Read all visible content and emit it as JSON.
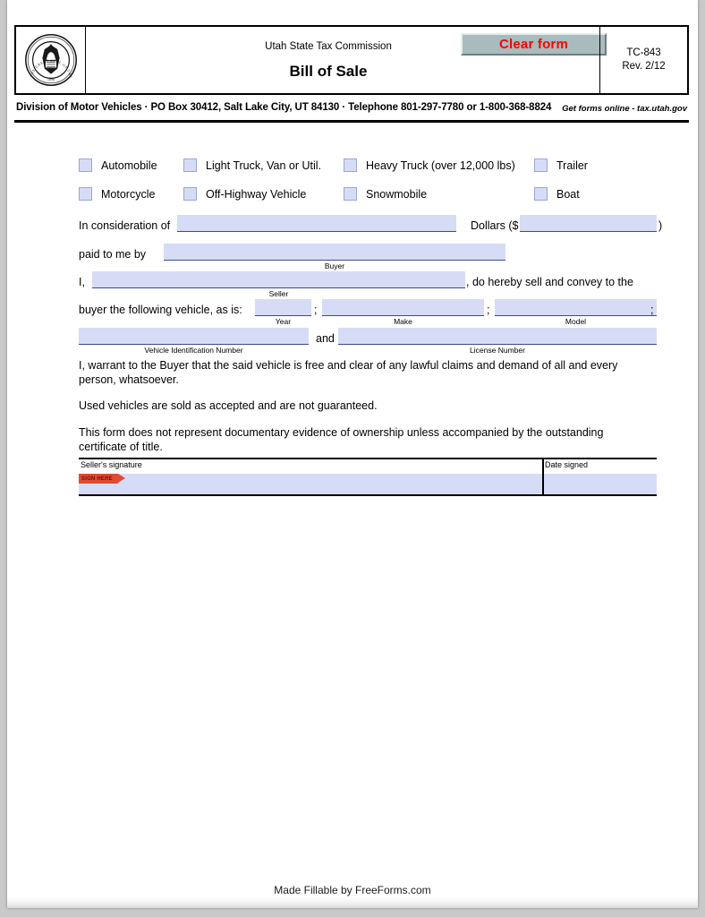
{
  "header": {
    "seal_name": "utah-state-seal",
    "agency": "Utah State Tax Commission",
    "title": "Bill of Sale",
    "clear_button": "Clear form",
    "form_code": "TC-843",
    "revision": "Rev. 2/12"
  },
  "division_line": "Division of Motor Vehicles · PO Box 30412, Salt Lake City, UT 84130 · Telephone 801-297-7780 or 1-800-368-8824",
  "get_forms": "Get forms online - tax.utah.gov",
  "vehicle_types": [
    {
      "label": "Automobile",
      "checked": false
    },
    {
      "label": "Light Truck, Van or Util.",
      "checked": false
    },
    {
      "label": "Heavy Truck (over 12,000 lbs)",
      "checked": false
    },
    {
      "label": "Trailer",
      "checked": false
    },
    {
      "label": "Motorcycle",
      "checked": false
    },
    {
      "label": "Off-Highway Vehicle",
      "checked": false
    },
    {
      "label": "Snowmobile",
      "checked": false
    },
    {
      "label": "Boat",
      "checked": false
    }
  ],
  "body": {
    "in_consideration_label": "In consideration of",
    "consideration_value": "",
    "dollars_label": "Dollars ($",
    "dollars_close": ")",
    "dollars_value": "",
    "paid_to_me_by_label": "paid to me by",
    "buyer_value": "",
    "buyer_caption": "Buyer",
    "i_label": "I,",
    "seller_value": "",
    "seller_caption": "Seller",
    "do_hereby_label": ", do hereby sell and convey to the",
    "buyer_following_label": "buyer the following vehicle, as is:",
    "year_value": "",
    "year_caption": "Year",
    "semicolon1": ";",
    "make_value": "",
    "make_caption": "Make",
    "semicolon2": ";",
    "model_value": "",
    "model_caption": "Model",
    "semicolon3": ";",
    "vin_value": "",
    "vin_caption": "Vehicle Identification Number",
    "and_label": "and",
    "license_value": "",
    "license_caption": "License Number",
    "paragraph1": "I, warrant to the Buyer that the said vehicle is free and clear of any lawful claims and demand of all and every person, whatsoever.",
    "paragraph2": "Used vehicles are sold as accepted and are not guaranteed.",
    "paragraph3": "This form does not represent documentary evidence of ownership unless accompanied by the outstanding certificate of title."
  },
  "signature": {
    "seller_signature_caption": "Seller's signature",
    "date_signed_caption": "Date signed",
    "sign_here_tag": "SIGN HERE",
    "seller_signature_value": "",
    "date_signed_value": ""
  },
  "footer": "Made Fillable by FreeForms.com",
  "colors": {
    "field_fill": "#d6dcf5",
    "field_underline": "#3c4a8c",
    "clear_button_bg": "#a9bcbd",
    "clear_button_text": "#ff0000",
    "sign_tag": "#e04b33"
  }
}
